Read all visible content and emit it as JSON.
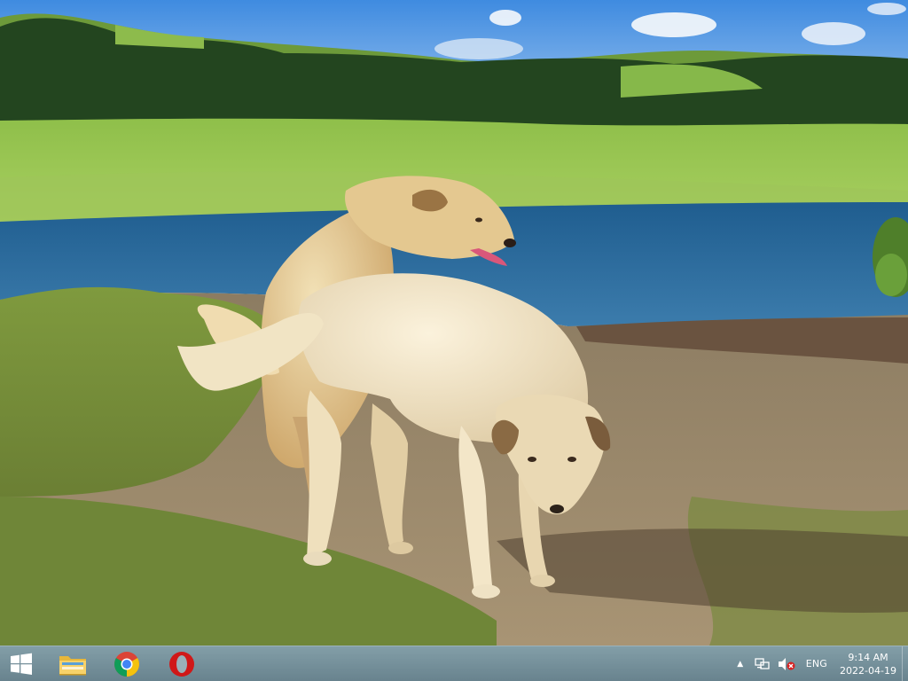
{
  "desktop": {
    "wallpaper_icon": "dogs-by-lake-photo"
  },
  "taskbar": {
    "start_icon": "windows-logo-icon",
    "pinned": [
      {
        "name": "File Explorer",
        "icon": "folder-icon"
      },
      {
        "name": "Google Chrome",
        "icon": "chrome-icon"
      },
      {
        "name": "Opera",
        "icon": "opera-icon"
      }
    ],
    "tray": {
      "chevron_icon": "chevron-up-icon",
      "network_icon": "network-icon",
      "volume_icon": "volume-muted-icon",
      "language": "ENG"
    },
    "clock": {
      "time": "9:14 AM",
      "date": "2022-04-19"
    }
  },
  "colors": {
    "taskbar": "#6f8c98",
    "start_logo": "#ffffff",
    "opera_red": "#d01818",
    "folder_yellow": "#f2c447",
    "mute_red": "#d62020"
  }
}
